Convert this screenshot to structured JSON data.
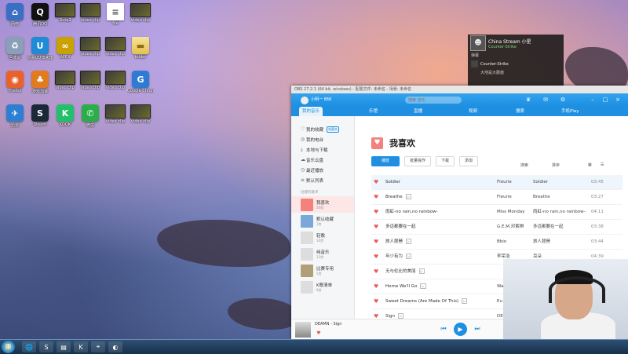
{
  "desktop": {
    "icons": [
      {
        "label": "网络",
        "type": "app",
        "color": "#3a6fc4",
        "glyph": "⌂"
      },
      {
        "label": "腾讯QQ",
        "type": "app",
        "color": "#111111",
        "glyph": "Q"
      },
      {
        "label": "Dota2",
        "type": "thumb"
      },
      {
        "label": "video clip",
        "type": "thumb"
      },
      {
        "label": "file",
        "type": "doc",
        "glyph": "≡"
      },
      {
        "label": "video clip",
        "type": "thumb"
      },
      {
        "label": "回收站",
        "type": "app",
        "color": "#8aa0b8",
        "glyph": "♻"
      },
      {
        "label": "网易UU加速器",
        "type": "app",
        "color": "#1f8ad6",
        "glyph": "U"
      },
      {
        "label": "APEX",
        "type": "app",
        "color": "#c9a200",
        "glyph": "∞"
      },
      {
        "label": "video clip",
        "type": "thumb"
      },
      {
        "label": "video clip",
        "type": "thumb"
      },
      {
        "label": "folder",
        "type": "folder",
        "glyph": "▬"
      },
      {
        "label": "Firefox",
        "type": "app",
        "color": "#e8632c",
        "glyph": "◉"
      },
      {
        "label": "游戏加速",
        "type": "app",
        "color": "#e27a1e",
        "glyph": "♣"
      },
      {
        "label": "video clip",
        "type": "thumb"
      },
      {
        "label": "video clip",
        "type": "thumb"
      },
      {
        "label": "video clip",
        "type": "thumb"
      },
      {
        "label": "Google Chrome",
        "type": "app",
        "color": "#2e7bd6",
        "glyph": "G"
      },
      {
        "label": "迅雷",
        "type": "app",
        "color": "#2d7fd2",
        "glyph": "✈"
      },
      {
        "label": "Steam",
        "type": "app",
        "color": "#1b2838",
        "glyph": "S"
      },
      {
        "label": "KOOK",
        "type": "app",
        "color": "#22c06a",
        "glyph": "K"
      },
      {
        "label": "微信",
        "type": "app",
        "color": "#2aae4a",
        "glyph": "✆"
      },
      {
        "label": "video clip",
        "type": "thumb"
      },
      {
        "label": "video clip",
        "type": "thumb"
      }
    ]
  },
  "stream": {
    "title": "China Stream 小星",
    "game": "Counter-Strike",
    "row": "弹幕",
    "list_game": "Counter-Strike",
    "list_sub": "大地是大蘑菇"
  },
  "obs": {
    "title": "OBS 27.2.1 (64 bit, windows) - 配置文件: 未命名 - 场景: 未命名"
  },
  "player": {
    "search_placeholder": "搜索 音乐",
    "user": "小明一 888",
    "nav": [
      "我的音乐",
      "乐馆",
      "直播",
      "视频",
      "搜索",
      "手机Play"
    ],
    "sidebar": {
      "items": [
        {
          "label": "我的收藏",
          "icon": "♡",
          "tag": "收藏夹"
        },
        {
          "label": "我的电台",
          "icon": "◎",
          "tag": ""
        },
        {
          "label": "本地与下载",
          "icon": "⤓",
          "tag": ""
        },
        {
          "label": "音乐云盘",
          "icon": "☁",
          "tag": ""
        },
        {
          "label": "最近播放",
          "icon": "◷",
          "tag": ""
        },
        {
          "label": "默认列表",
          "icon": "≡",
          "tag": ""
        }
      ],
      "section": "创建的歌单",
      "playlists": [
        {
          "name": "我喜欢",
          "count": "30首",
          "color": "#f4817c"
        },
        {
          "name": "默认收藏",
          "count": "3首",
          "color": "#7aa8d8"
        },
        {
          "name": "轻歌",
          "count": "10首",
          "color": "#ddd"
        },
        {
          "name": "纯音乐",
          "count": "12首",
          "color": "#ddd"
        },
        {
          "name": "比赛专用",
          "count": "5首",
          "color": "#b0a07a"
        },
        {
          "name": "K歌清单",
          "count": "8首",
          "color": "#ddd"
        }
      ]
    },
    "main": {
      "title": "我喜欢",
      "actions": {
        "play": "播放",
        "batch": "批量操作",
        "download": "下载",
        "add": "添加"
      },
      "search": "搜索",
      "sort": "排序",
      "songs": [
        {
          "title": "Soldier",
          "artist": "Fleurie",
          "album": "Soldier",
          "duration": "03:45",
          "mv": false
        },
        {
          "title": "Breathe",
          "artist": "Fleurie",
          "album": "Breathe",
          "duration": "03:27",
          "mv": true
        },
        {
          "title": "雨虹-no rain,no rainbow-",
          "artist": "Miss Monday",
          "album": "雨虹-no rain,no rainbow-",
          "duration": "04:11",
          "mv": false
        },
        {
          "title": "多远都要在一起",
          "artist": "G.E.M.邓紫棋",
          "album": "多远都要在一起",
          "duration": "03:38",
          "mv": false
        },
        {
          "title": "旅人琵琶",
          "artist": "Bbio",
          "album": "旅人琵琶",
          "duration": "03:44",
          "mv": true
        },
        {
          "title": "年少有为",
          "artist": "李荣浩",
          "album": "耳朵",
          "duration": "04:39",
          "mv": true
        },
        {
          "title": "无与伦比的美丽",
          "artist": "",
          "album": "",
          "duration": "",
          "mv": true
        },
        {
          "title": "Home We'll Go",
          "artist": "Wa",
          "album": "",
          "duration": "",
          "mv": true
        },
        {
          "title": "Sweet Dreams (Are Made Of This)",
          "artist": "Eu",
          "album": "",
          "duration": "",
          "mv": true
        },
        {
          "title": "Sign",
          "artist": "DEA",
          "album": "",
          "duration": "",
          "mv": true
        }
      ]
    },
    "playbar": {
      "song": "DEAMN - Sign"
    }
  },
  "taskbar": {
    "items": [
      "🌐",
      "S",
      "▤",
      "K",
      "⌖",
      "◐"
    ]
  }
}
